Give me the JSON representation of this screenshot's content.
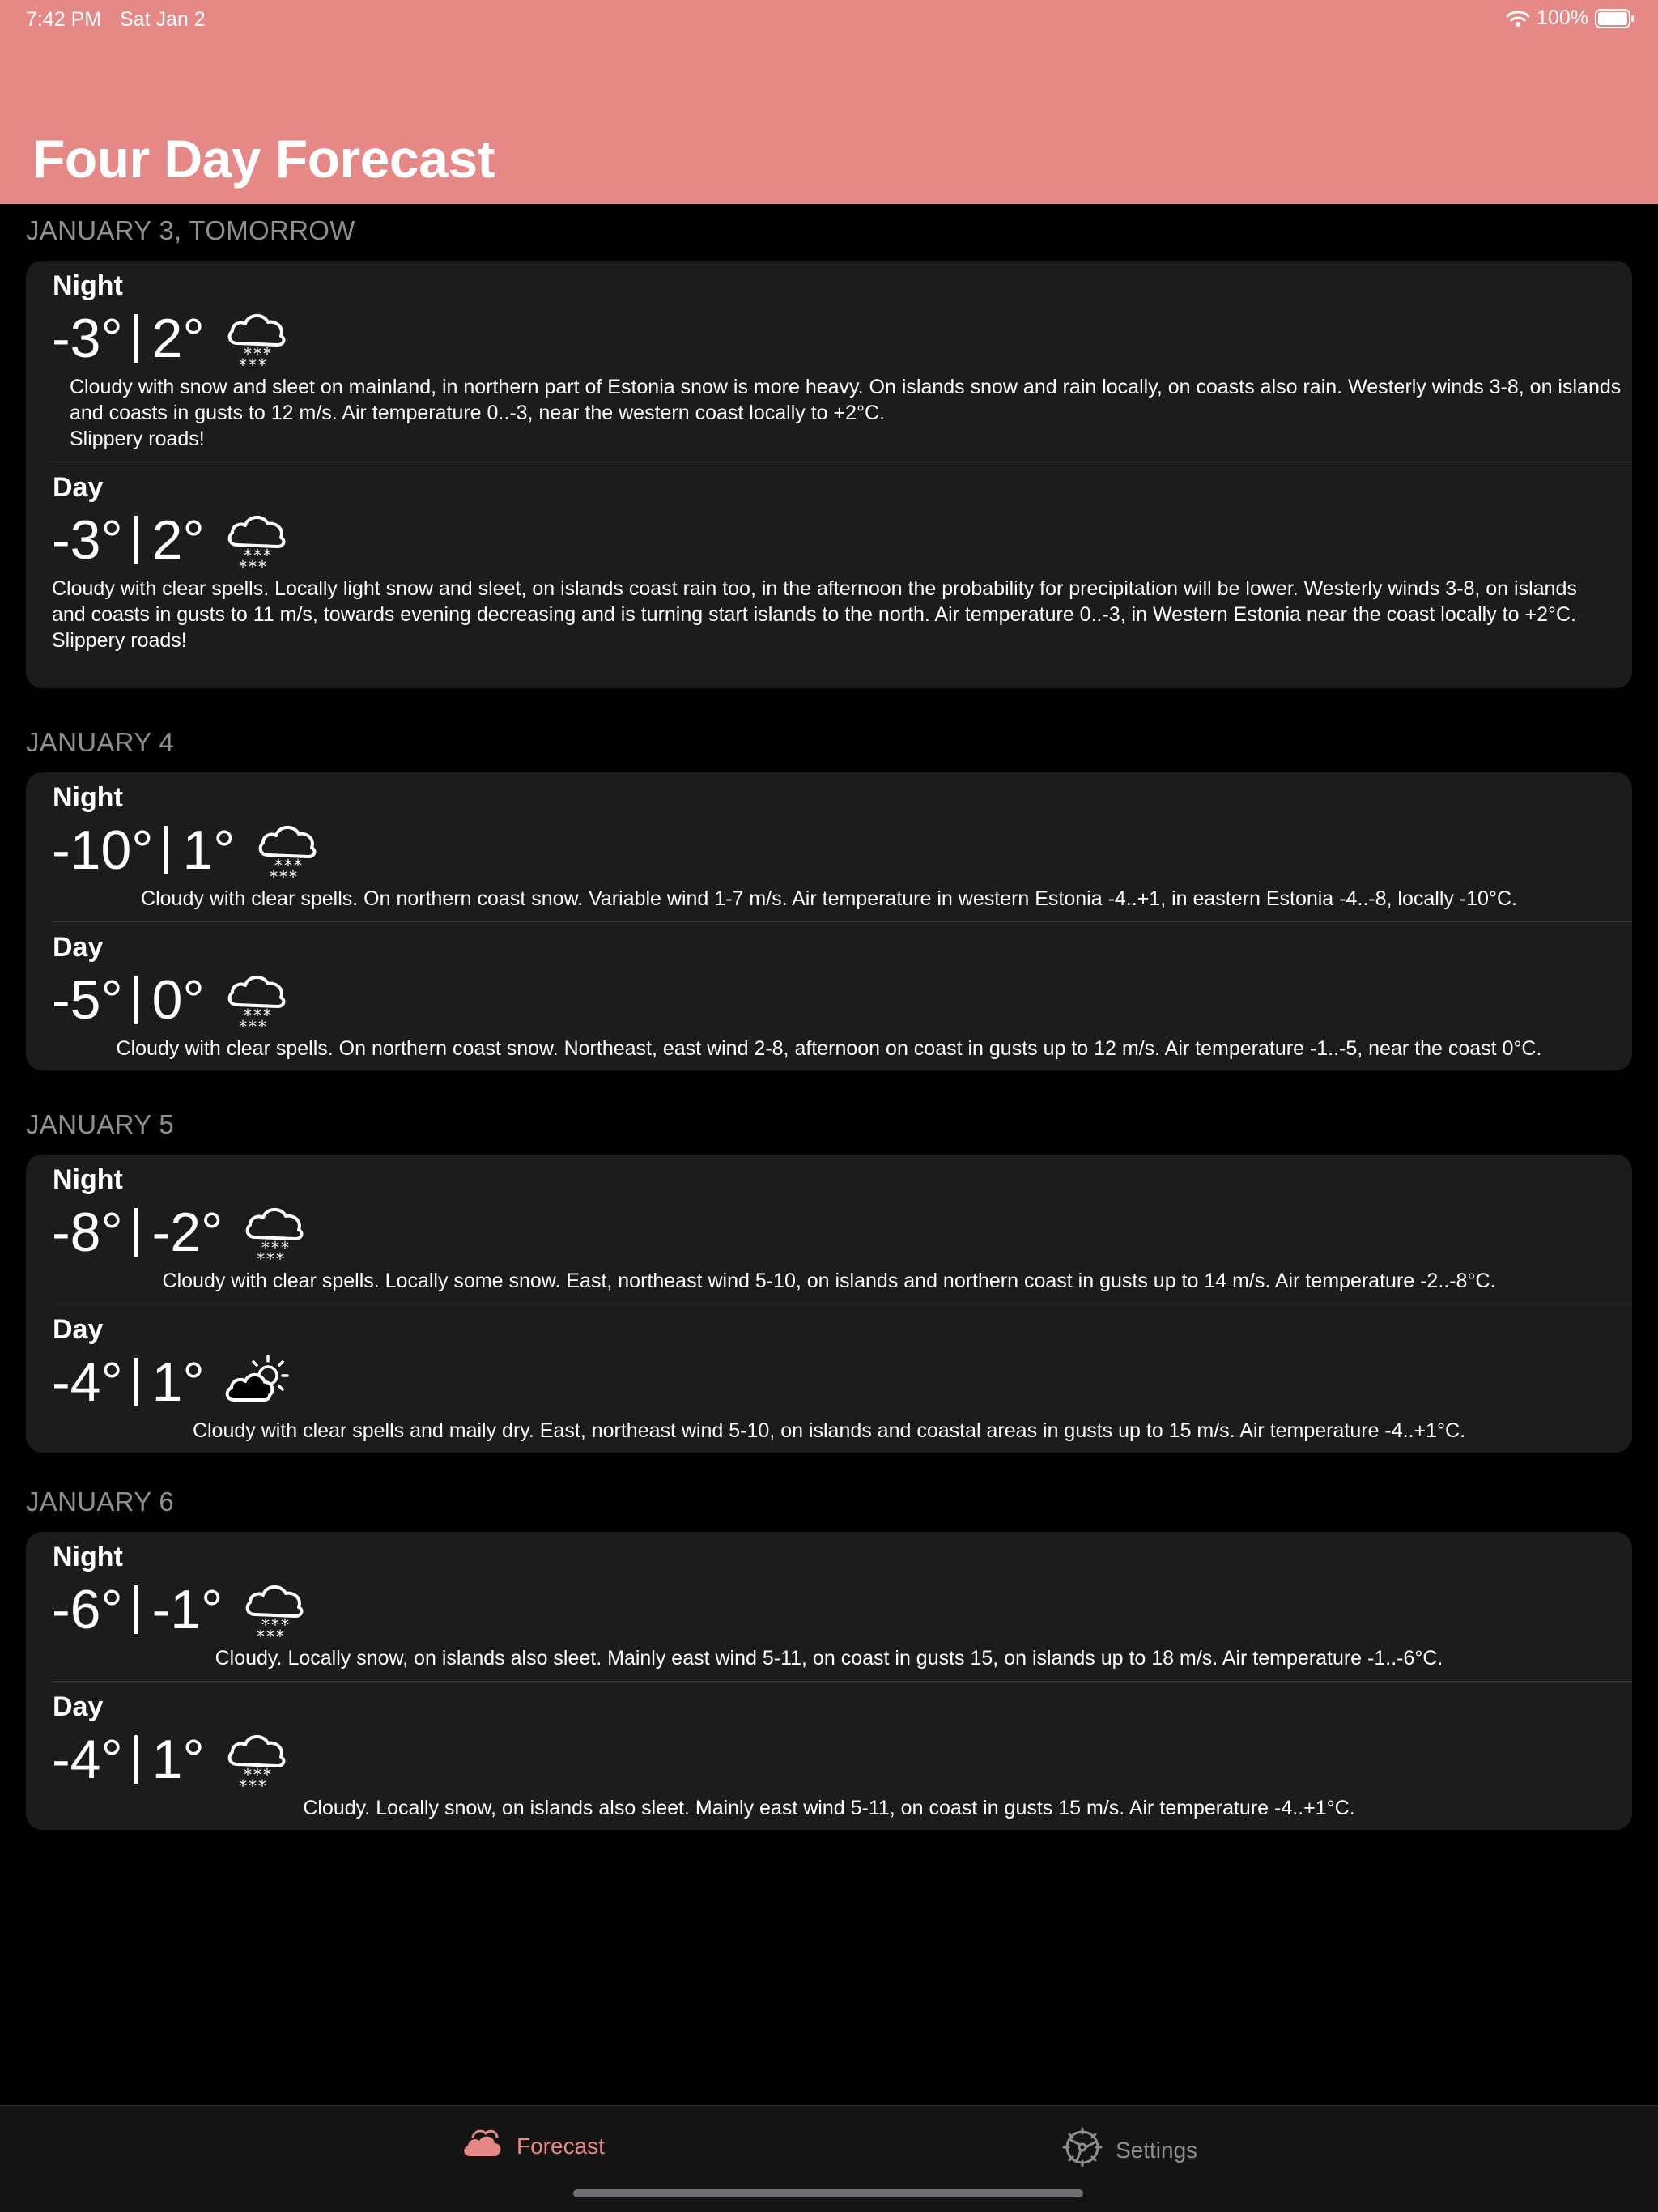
{
  "status_bar": {
    "time": "7:42 PM",
    "date": "Sat Jan 2",
    "battery": "100%"
  },
  "title": "Four Day Forecast",
  "days": [
    {
      "header": "JANUARY 3, TOMORROW",
      "night": {
        "label": "Night",
        "low": "-3°",
        "high": "2°",
        "icon": "cloud-snow-icon",
        "description": "Cloudy with snow and sleet on mainland, in northern part of Estonia snow is more heavy. On  islands snow and rain locally, on coasts also rain. Westerly winds 3-8, on islands and coasts in gusts to 12 m/s. Air temperature 0..-3, near the western coast locally to +2°C.\nSlippery roads!"
      },
      "day": {
        "label": "Day",
        "low": "-3°",
        "high": "2°",
        "icon": "cloud-snow-icon",
        "description": "Cloudy with clear spells. Locally light snow and sleet, on islands coast rain too,  in the afternoon the probability for precipitation will be lower. Westerly winds 3-8, on islands and coasts in gusts to 11 m/s, towards evening decreasing and is turning start islands to the north. Air temperature 0..-3, in Western Estonia near the coast locally to +2°C.\nSlippery roads!"
      }
    },
    {
      "header": "JANUARY 4",
      "night": {
        "label": "Night",
        "low": "-10°",
        "high": "1°",
        "icon": "cloud-snow-icon",
        "description": "Cloudy with clear spells. On northern coast snow. Variable wind 1-7 m/s. Air temperature in western Estonia -4..+1, in eastern Estonia -4..-8, locally -10°C."
      },
      "day": {
        "label": "Day",
        "low": "-5°",
        "high": "0°",
        "icon": "cloud-snow-icon",
        "description": "Cloudy with clear spells. On northern coast snow. Northeast, east wind 2-8, afternoon on coast in gusts up to 12 m/s. Air temperature -1..-5, near the coast 0°C."
      }
    },
    {
      "header": "JANUARY 5",
      "night": {
        "label": "Night",
        "low": "-8°",
        "high": "-2°",
        "icon": "cloud-snow-icon",
        "description": "Cloudy with clear spells. Locally some snow. East, northeast wind 5-10, on islands and northern coast in gusts up to 14 m/s. Air temperature -2..-8°C."
      },
      "day": {
        "label": "Day",
        "low": "-4°",
        "high": "1°",
        "icon": "cloud-sun-icon",
        "description": "Cloudy with clear spells and maily dry. East, northeast wind 5-10, on islands and coastal areas in gusts up to 15 m/s. Air temperature -4..+1°C."
      }
    },
    {
      "header": "JANUARY 6",
      "night": {
        "label": "Night",
        "low": "-6°",
        "high": "-1°",
        "icon": "cloud-snow-icon",
        "description": "Cloudy. Locally snow, on islands also sleet. Mainly east wind 5-11, on coast in gusts 15, on islands up to 18 m/s. Air temperature -1..-6°C."
      },
      "day": {
        "label": "Day",
        "low": "-4°",
        "high": "1°",
        "icon": "cloud-snow-icon",
        "description": "Cloudy. Locally snow, on islands also sleet. Mainly east wind 5-11, on coast in gusts 15 m/s. Air temperature -4..+1°C."
      }
    }
  ],
  "tabbar": {
    "forecast_label": "Forecast",
    "settings_label": "Settings",
    "forecast_icon": "cloud-icon",
    "settings_icon": "gear-icon",
    "active_color": "#e58886",
    "inactive_color": "#8e8e93"
  },
  "colors": {
    "header": "#e58886",
    "background": "#000000",
    "card": "#1c1c1e",
    "section_header": "#8e8e93"
  }
}
